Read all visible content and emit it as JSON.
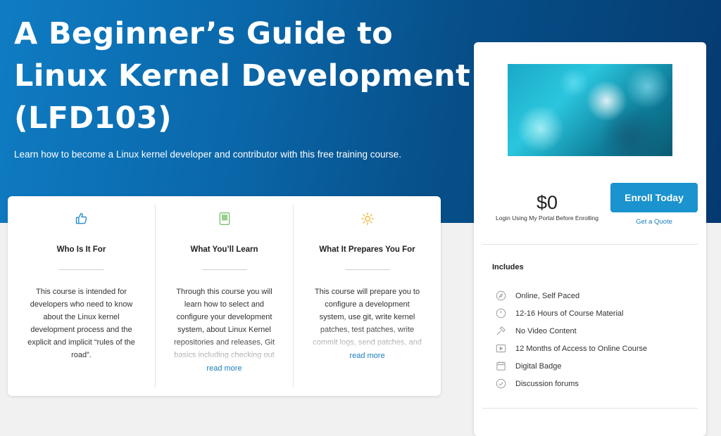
{
  "hero": {
    "title": "A Beginner’s Guide to Linux Kernel Development (LFD103)",
    "subtitle": "Learn how to become a Linux kernel developer and contributor with this free training course."
  },
  "info": {
    "columns": [
      {
        "icon": "thumbs-up-icon",
        "heading": "Who Is It For",
        "text": "This course is intended for developers who need to know about the Linux kernel development process and the explicit and implicit “rules of the road”.",
        "readmore": ""
      },
      {
        "icon": "clipboard-icon",
        "heading": "What You’ll Learn",
        "text": "Through this course you will learn how to select and configure your development system, about Linux Kernel repositories and releases, Git basics including checking out kernel repositories and working",
        "readmore": "read more"
      },
      {
        "icon": "sun-icon",
        "heading": "What It Prepares You For",
        "text": "This course will prepare you to configure a development system, use git, write kernel patches, test patches, write commit logs, send patches, and work with the Linux kernel",
        "readmore": "read more"
      }
    ]
  },
  "sidebar": {
    "price": "$0",
    "price_note": "Login Using My Portal Before Enrolling",
    "enroll_label": "Enroll Today",
    "quote_label": "Get a Quote",
    "includes_title": "Includes",
    "includes": [
      {
        "icon": "compass-icon",
        "label": "Online, Self Paced"
      },
      {
        "icon": "clock-icon",
        "label": "12-16 Hours of Course Material"
      },
      {
        "icon": "hammer-icon",
        "label": "No Video Content"
      },
      {
        "icon": "video-icon",
        "label": "12 Months of Access to Online Course"
      },
      {
        "icon": "calendar-icon",
        "label": "Digital Badge"
      },
      {
        "icon": "check-circle-icon",
        "label": "Discussion forums"
      }
    ]
  },
  "colors": {
    "accent": "#1a93cf",
    "link": "#1a7dbb",
    "hero_dark": "#053a70",
    "hero_light": "#0f7cc3"
  }
}
